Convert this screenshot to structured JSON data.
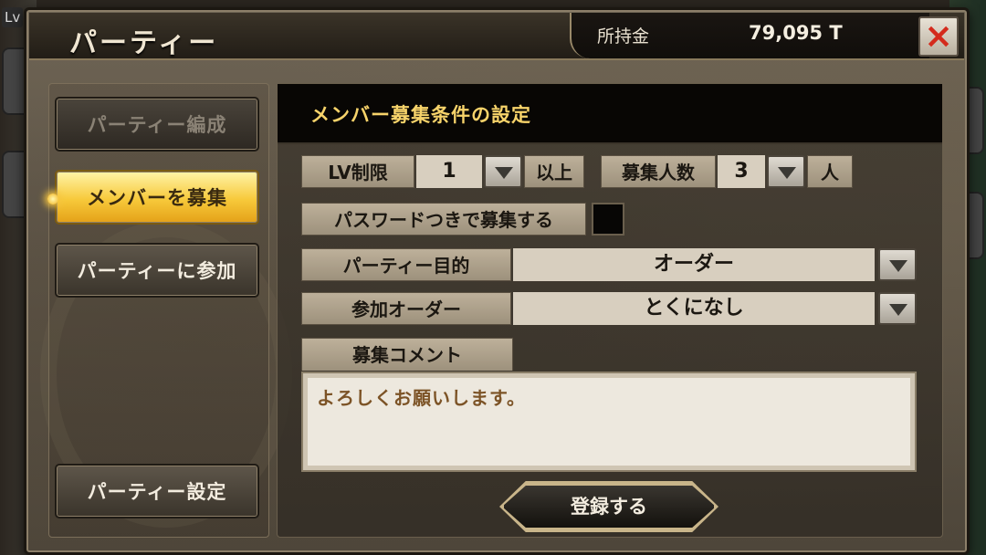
{
  "background": {
    "level_prefix": "Lv"
  },
  "header": {
    "title": "パーティー",
    "money_label": "所持金",
    "money_value": "79,095 T",
    "close_icon": "×"
  },
  "menu": {
    "items": [
      {
        "label": "パーティー編成",
        "state": "disabled"
      },
      {
        "label": "メンバーを募集",
        "state": "active"
      },
      {
        "label": "パーティーに参加",
        "state": "normal"
      }
    ],
    "settings_label": "パーティー設定"
  },
  "form": {
    "section_title": "メンバー募集条件の設定",
    "lv_label": "LV制限",
    "lv_value": "1",
    "lv_suffix": "以上",
    "members_label": "募集人数",
    "members_value": "3",
    "members_suffix": "人",
    "password_label": "パスワードつきで募集する",
    "purpose_label": "パーティー目的",
    "purpose_value": "オーダー",
    "order_label": "参加オーダー",
    "order_value": "とくになし",
    "comment_label": "募集コメント",
    "comment_value": "よろしくお願いします。",
    "submit_label": "登録する"
  },
  "colors": {
    "accent_gold": "#f7d36a",
    "close_red": "#d42a1c"
  }
}
